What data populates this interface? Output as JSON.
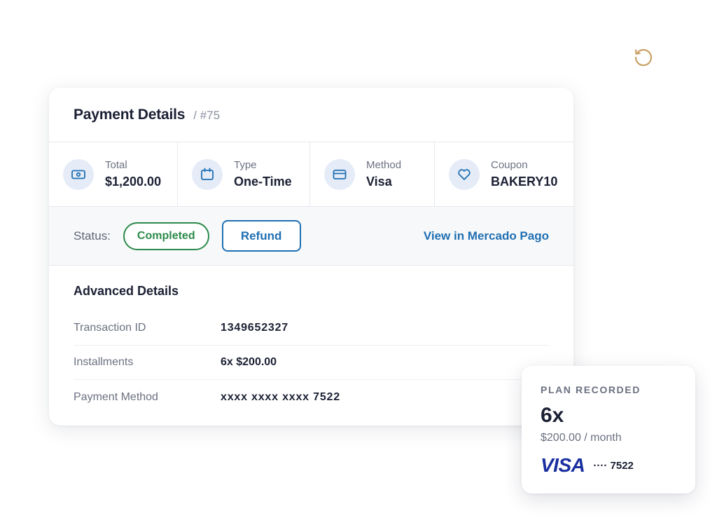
{
  "header": {
    "title": "Payment Details",
    "id": "/ #75"
  },
  "summary": [
    {
      "label": "Total",
      "value": "$1,200.00",
      "icon": "cash-icon"
    },
    {
      "label": "Type",
      "value": "One-Time",
      "icon": "calendar-icon"
    },
    {
      "label": "Method",
      "value": "Visa",
      "icon": "credit-card-icon"
    },
    {
      "label": "Coupon",
      "value": "BAKERY10",
      "icon": "heart-icon"
    }
  ],
  "status": {
    "label": "Status:",
    "badge": "Completed",
    "refund_label": "Refund",
    "link_label": "View in Mercado Pago"
  },
  "advanced": {
    "title": "Advanced Details",
    "rows": [
      {
        "label": "Transaction ID",
        "value": "1349652327"
      },
      {
        "label": "Installments",
        "value": "6x $200.00"
      },
      {
        "label": "Payment Method",
        "value": "xxxx xxxx xxxx 7522"
      }
    ]
  },
  "plan": {
    "eyebrow": "PLAN RECORDED",
    "value": "6x",
    "sub": "$200.00 / month",
    "brand": "VISA",
    "last4": "···· 7522"
  },
  "colors": {
    "accent_blue": "#1f6fb2",
    "success_green": "#2b8a4a",
    "icon_bg": "#e5ecf8",
    "refresh_gold": "#c9a267",
    "visa_blue": "#1a2fa0"
  }
}
